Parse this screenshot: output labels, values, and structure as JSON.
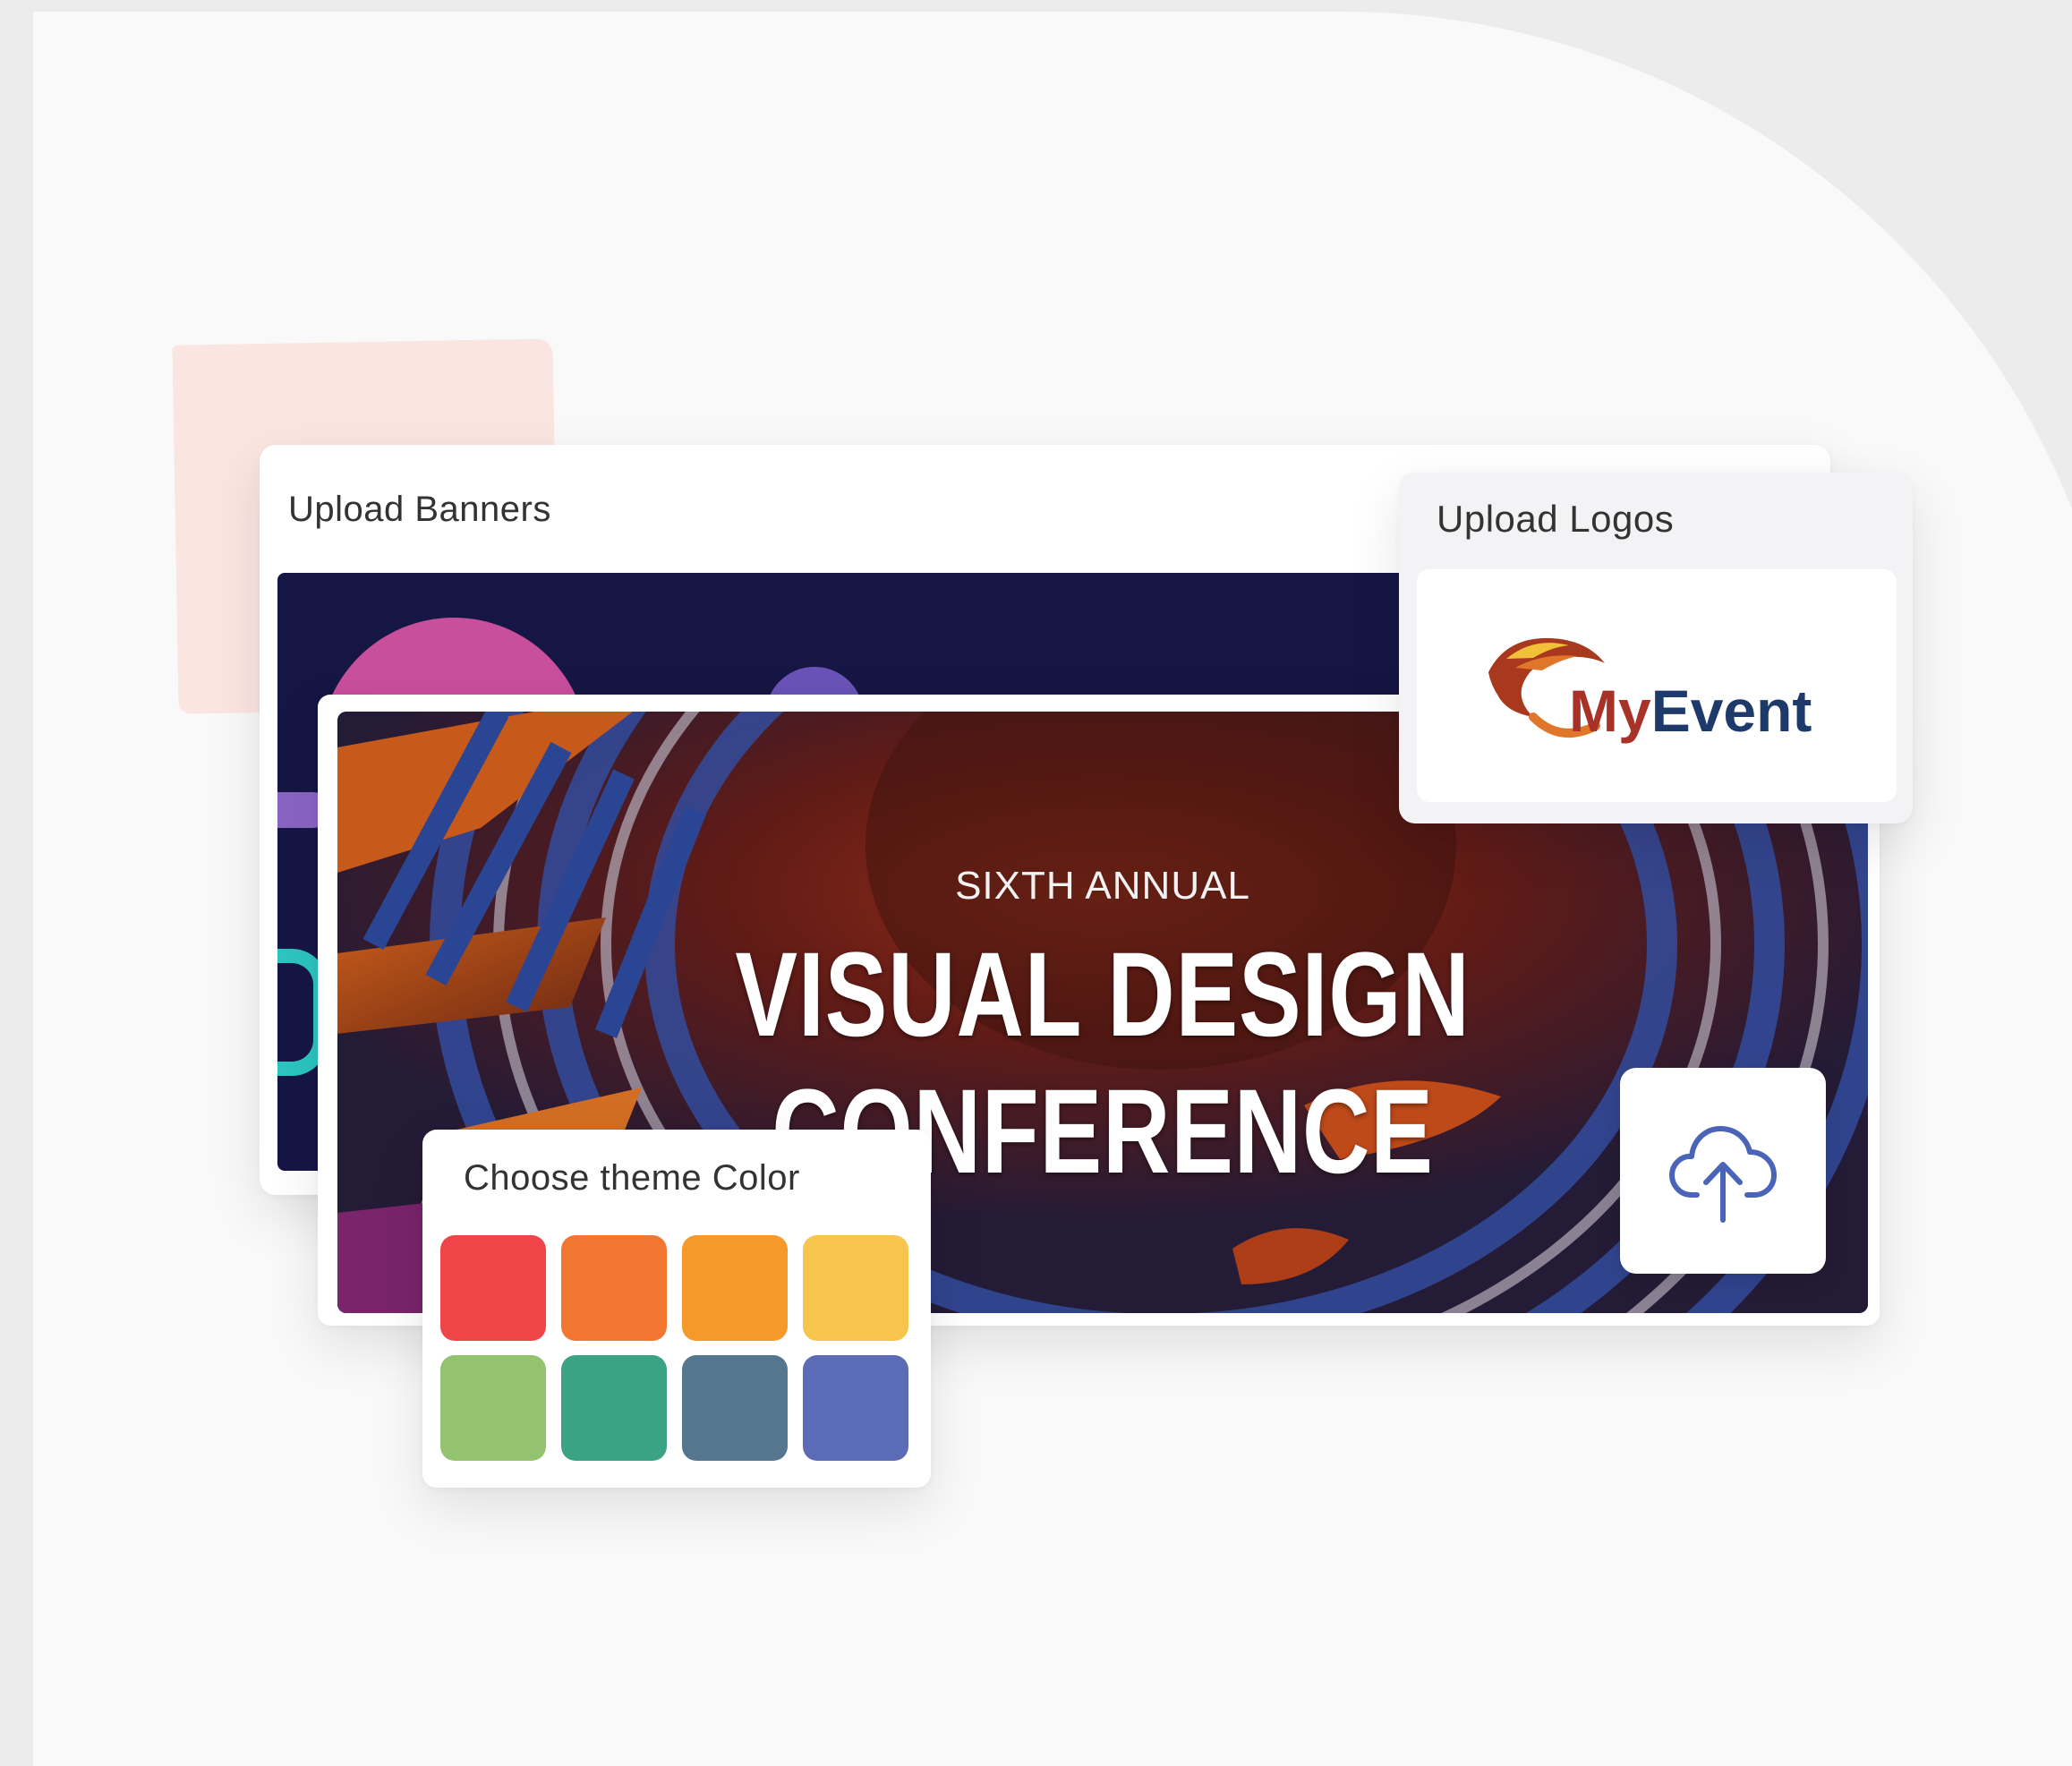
{
  "upload_banners": {
    "title": "Upload Banners"
  },
  "banner": {
    "subtitle": "SIXTH ANNUAL",
    "title": "VISUAL DESIGN CONFERENCE"
  },
  "upload_logos": {
    "title": "Upload Logos",
    "logo": {
      "text_my": "My",
      "text_event": "Event"
    }
  },
  "theme": {
    "title": "Choose theme Color",
    "colors": [
      "#ef4549",
      "#f27530",
      "#f6992b",
      "#f7c54d",
      "#93c36e",
      "#3aa384",
      "#55768f",
      "#5b6bb5"
    ]
  },
  "upload_button": {
    "icon": "cloud-upload-icon"
  }
}
